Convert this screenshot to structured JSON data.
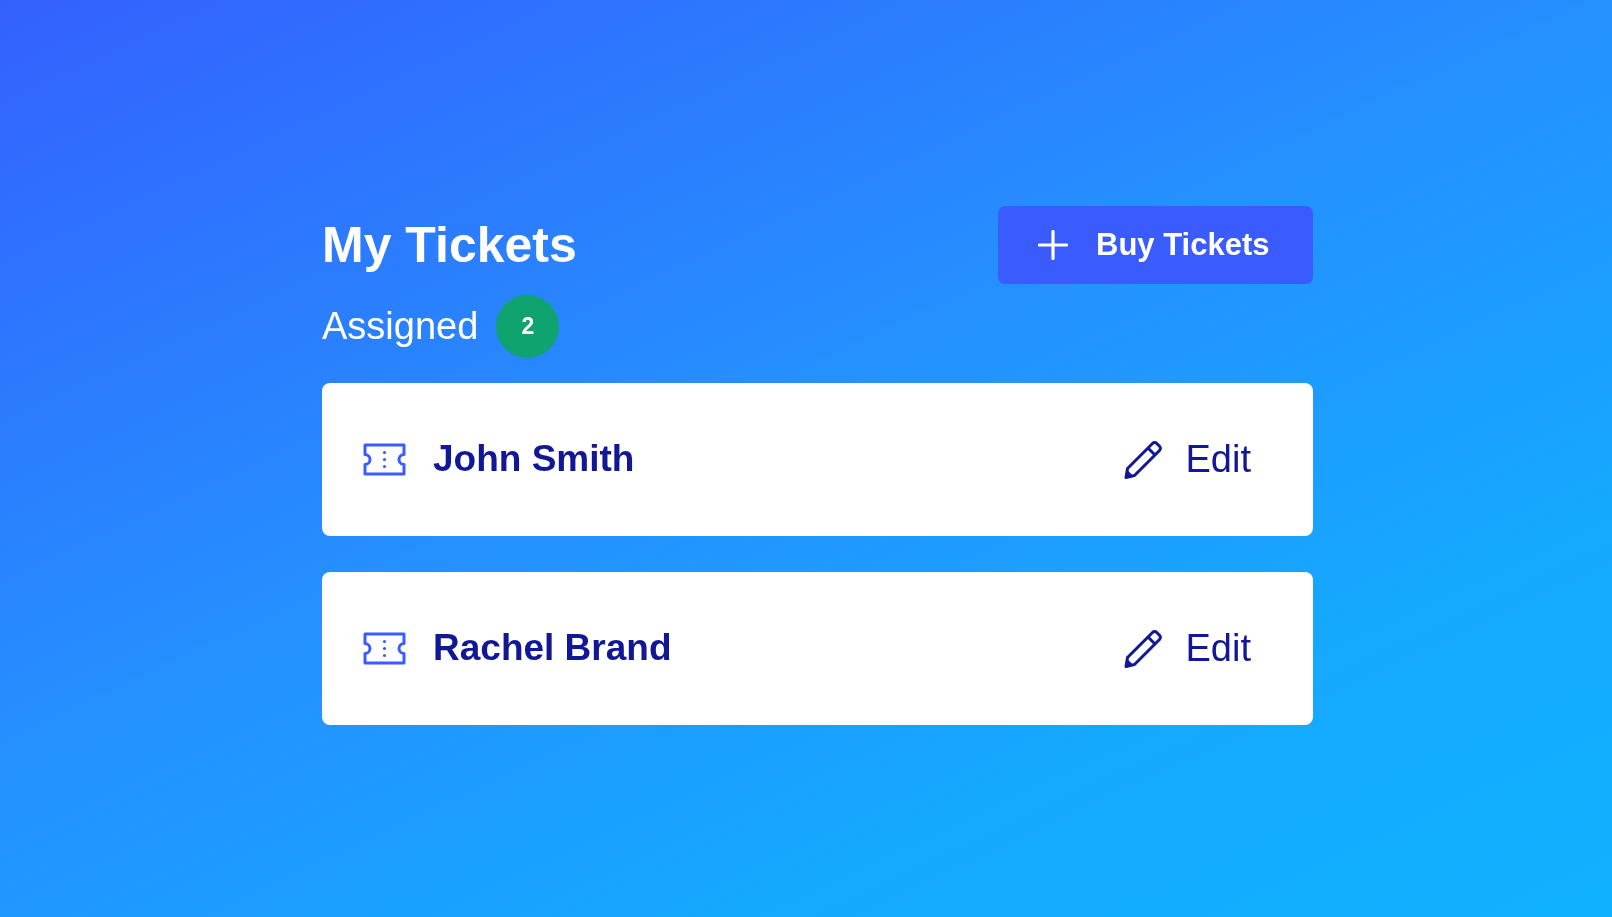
{
  "header": {
    "title": "My Tickets",
    "button": {
      "label": "Buy Tickets"
    }
  },
  "assigned": {
    "label": "Assigned",
    "count": "2"
  },
  "tickets": [
    {
      "name": "John Smith",
      "action": "Edit"
    },
    {
      "name": "Rachel Brand",
      "action": "Edit"
    }
  ]
}
